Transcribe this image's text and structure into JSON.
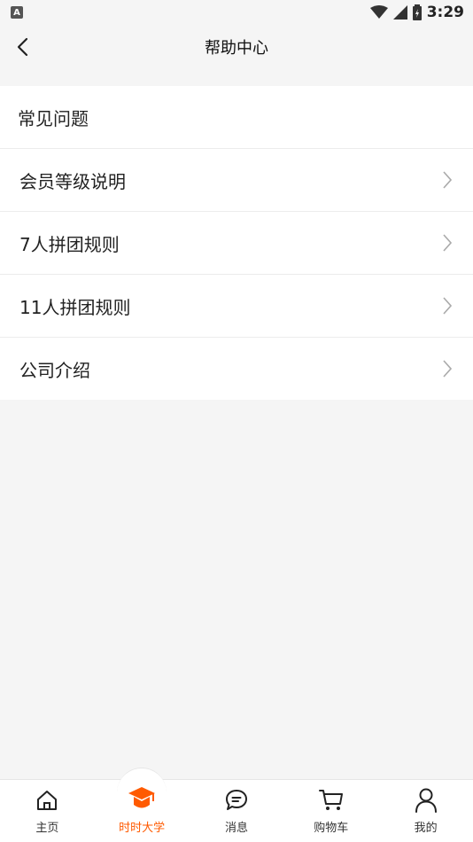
{
  "status_bar": {
    "left_badge": "A",
    "time": "3:29"
  },
  "header": {
    "title": "帮助中心",
    "back_icon": "chevron-left-icon"
  },
  "section": {
    "title": "常见问题"
  },
  "items": [
    {
      "label": "会员等级说明",
      "icon": "chevron-right-icon"
    },
    {
      "label": "7人拼团规则",
      "icon": "chevron-right-icon"
    },
    {
      "label": "11人拼团规则",
      "icon": "chevron-right-icon"
    },
    {
      "label": "公司介绍",
      "icon": "chevron-right-icon"
    }
  ],
  "tabbar": {
    "active_color": "#ff5a00",
    "tabs": [
      {
        "label": "主页",
        "icon": "home-icon"
      },
      {
        "label": "时时大学",
        "icon": "graduation-cap-icon",
        "active": true
      },
      {
        "label": "消息",
        "icon": "message-icon"
      },
      {
        "label": "购物车",
        "icon": "cart-icon"
      },
      {
        "label": "我的",
        "icon": "user-icon"
      }
    ]
  }
}
